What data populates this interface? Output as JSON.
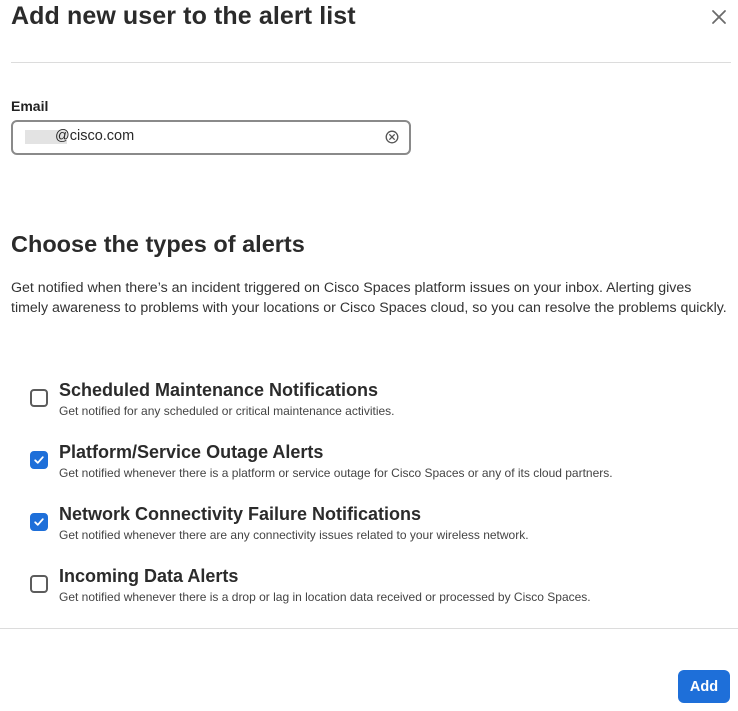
{
  "dialog": {
    "title": "Add new user to the alert list",
    "close_icon": "close-icon"
  },
  "email": {
    "label": "Email",
    "value": "@cisco.com",
    "clear_icon": "clear-circle-icon"
  },
  "alerts_section": {
    "title": "Choose the types of alerts",
    "description": "Get notified when there’s an incident triggered on Cisco Spaces platform issues on your inbox. Alerting gives timely awareness to problems with your locations or Cisco Spaces cloud, so you can resolve the problems quickly.",
    "items": [
      {
        "title": "Scheduled Maintenance Notifications",
        "description": "Get notified for any scheduled or critical maintenance activities.",
        "checked": false
      },
      {
        "title": "Platform/Service Outage Alerts",
        "description": "Get notified whenever there is a platform or service outage for Cisco Spaces or any of its cloud partners.",
        "checked": true
      },
      {
        "title": "Network Connectivity Failure Notifications",
        "description": "Get notified whenever there are any connectivity issues related to your wireless network.",
        "checked": true
      },
      {
        "title": "Incoming Data Alerts",
        "description": "Get notified whenever there is a drop or lag in location data received or processed by Cisco Spaces.",
        "checked": false
      }
    ]
  },
  "footer": {
    "add_label": "Add"
  },
  "colors": {
    "accent": "#1e6fd9",
    "border": "#8a8a8a",
    "divider": "#dcdcdc"
  }
}
